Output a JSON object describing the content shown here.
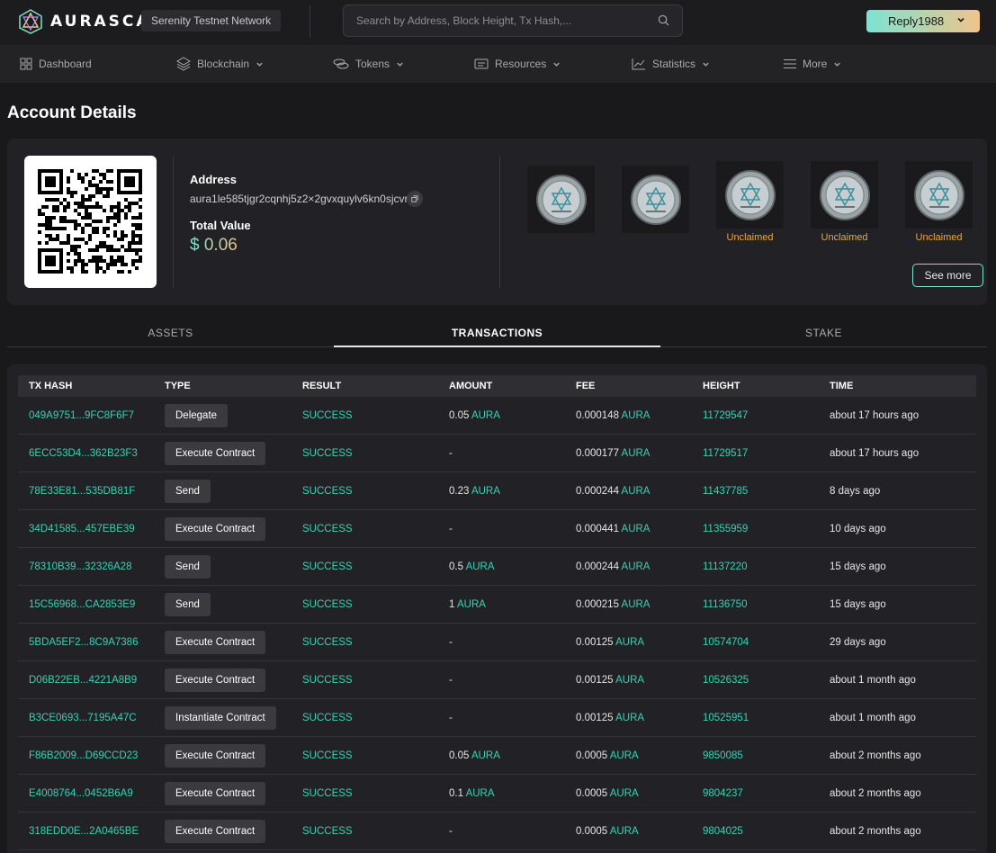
{
  "header": {
    "logo_text": "AURASCAN",
    "network": "Serenity Testnet Network",
    "search_placeholder": "Search by Address, Block Height, Tx Hash,...",
    "user": "Reply1988"
  },
  "nav": {
    "items": [
      {
        "label": "Dashboard",
        "icon": "grid-icon"
      },
      {
        "label": "Blockchain",
        "icon": "layers-icon"
      },
      {
        "label": "Tokens",
        "icon": "coins-icon"
      },
      {
        "label": "Resources",
        "icon": "card-icon"
      },
      {
        "label": "Statistics",
        "icon": "chart-icon"
      },
      {
        "label": "More",
        "icon": "menu-icon"
      }
    ]
  },
  "page": {
    "title": "Account Details",
    "address_label": "Address",
    "address": "aura1le585tjgr2cqnhj5z2×2gvxquylv6kn0sjcvrq",
    "total_value_label": "Total Value",
    "total_value": "$ 0.06",
    "nfts": [
      {
        "status": ""
      },
      {
        "status": ""
      },
      {
        "status": "Unclaimed"
      },
      {
        "status": "Unclaimed"
      },
      {
        "status": "Unclaimed"
      }
    ],
    "see_more": "See more"
  },
  "tabs": {
    "assets": "ASSETS",
    "transactions": "TRANSACTIONS",
    "stake": "STAKE",
    "active": "TRANSACTIONS"
  },
  "table": {
    "columns": {
      "tx_hash": "TX HASH",
      "type": "TYPE",
      "result": "RESULT",
      "amount": "AMOUNT",
      "fee": "FEE",
      "height": "HEIGHT",
      "time": "TIME"
    },
    "rows": [
      {
        "hash": "049A9751...9FC8F6F7",
        "type": "Delegate",
        "result": "SUCCESS",
        "amount": "0.05",
        "amount_unit": "AURA",
        "fee": "0.000148",
        "fee_unit": "AURA",
        "height": "11729547",
        "time": "about 17 hours ago"
      },
      {
        "hash": "6ECC53D4...362B23F3",
        "type": "Execute Contract",
        "result": "SUCCESS",
        "amount": "-",
        "amount_unit": "",
        "fee": "0.000177",
        "fee_unit": "AURA",
        "height": "11729517",
        "time": "about 17 hours ago"
      },
      {
        "hash": "78E33E81...535DB81F",
        "type": "Send",
        "result": "SUCCESS",
        "amount": "0.23",
        "amount_unit": "AURA",
        "fee": "0.000244",
        "fee_unit": "AURA",
        "height": "11437785",
        "time": "8 days ago"
      },
      {
        "hash": "34D41585...457EBE39",
        "type": "Execute Contract",
        "result": "SUCCESS",
        "amount": "-",
        "amount_unit": "",
        "fee": "0.000441",
        "fee_unit": "AURA",
        "height": "11355959",
        "time": "10 days ago"
      },
      {
        "hash": "78310B39...32326A28",
        "type": "Send",
        "result": "SUCCESS",
        "amount": "0.5",
        "amount_unit": "AURA",
        "fee": "0.000244",
        "fee_unit": "AURA",
        "height": "11137220",
        "time": "15 days ago"
      },
      {
        "hash": "15C56968...CA2853E9",
        "type": "Send",
        "result": "SUCCESS",
        "amount": "1",
        "amount_unit": "AURA",
        "fee": "0.000215",
        "fee_unit": "AURA",
        "height": "11136750",
        "time": "15 days ago"
      },
      {
        "hash": "5BDA5EF2...8C9A7386",
        "type": "Execute Contract",
        "result": "SUCCESS",
        "amount": "-",
        "amount_unit": "",
        "fee": "0.00125",
        "fee_unit": "AURA",
        "height": "10574704",
        "time": "29 days ago"
      },
      {
        "hash": "D06B22EB...4221A8B9",
        "type": "Execute Contract",
        "result": "SUCCESS",
        "amount": "-",
        "amount_unit": "",
        "fee": "0.00125",
        "fee_unit": "AURA",
        "height": "10526325",
        "time": "about 1 month ago"
      },
      {
        "hash": "B3CE0693...7195A47C",
        "type": "Instantiate Contract",
        "result": "SUCCESS",
        "amount": "-",
        "amount_unit": "",
        "fee": "0.00125",
        "fee_unit": "AURA",
        "height": "10525951",
        "time": "about 1 month ago"
      },
      {
        "hash": "F86B2009...D69CCD23",
        "type": "Execute Contract",
        "result": "SUCCESS",
        "amount": "0.05",
        "amount_unit": "AURA",
        "fee": "0.0005",
        "fee_unit": "AURA",
        "height": "9850085",
        "time": "about 2 months ago"
      },
      {
        "hash": "E4008764...0452B6A9",
        "type": "Execute Contract",
        "result": "SUCCESS",
        "amount": "0.1",
        "amount_unit": "AURA",
        "fee": "0.0005",
        "fee_unit": "AURA",
        "height": "9804237",
        "time": "about 2 months ago"
      },
      {
        "hash": "318EDD0E...2A0465BE",
        "type": "Execute Contract",
        "result": "SUCCESS",
        "amount": "-",
        "amount_unit": "",
        "fee": "0.0005",
        "fee_unit": "AURA",
        "height": "9804025",
        "time": "about 2 months ago"
      }
    ]
  },
  "colors": {
    "accent": "#3ad0b4",
    "warning": "#f0a53d",
    "background": "#19191b"
  }
}
